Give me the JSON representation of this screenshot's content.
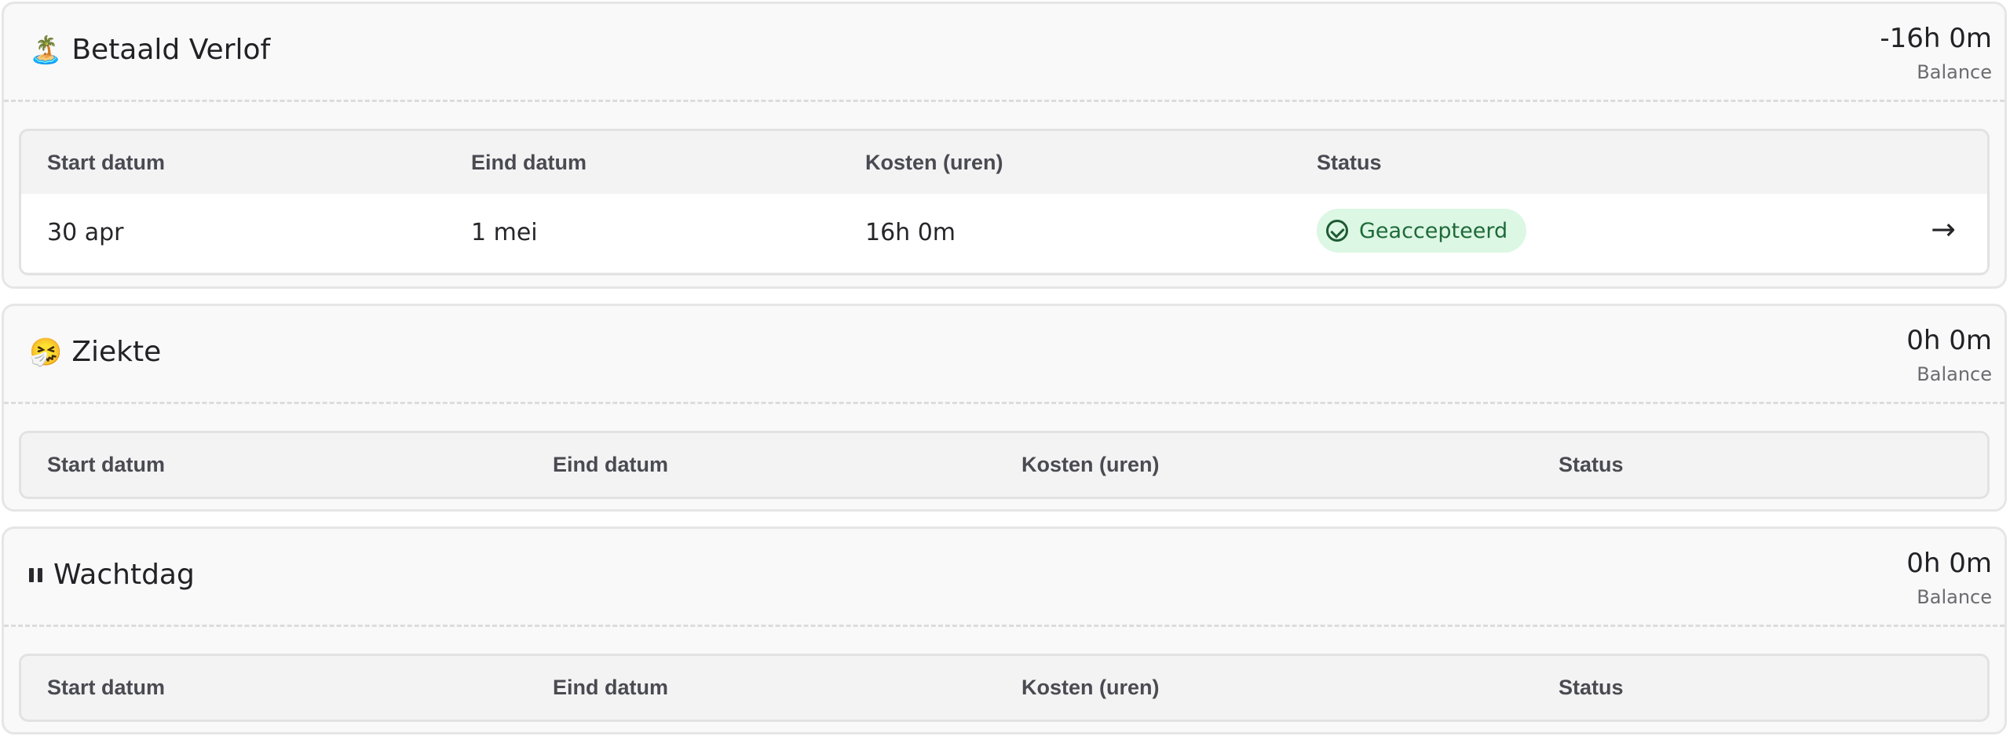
{
  "table_headers": {
    "start": "Start datum",
    "end": "Eind datum",
    "cost": "Kosten (uren)",
    "status": "Status"
  },
  "sections": [
    {
      "title": "Betaald Verlof",
      "emoji": "🏝️",
      "icon": "island-icon",
      "balance": "-16h 0m",
      "balance_label": "Balance",
      "rows": [
        {
          "start": "30 apr",
          "end": "1 mei",
          "cost": "16h 0m",
          "status": "Geaccepteerd"
        }
      ]
    },
    {
      "title": "Ziekte",
      "emoji": "🤧",
      "icon": "sneezing-face-icon",
      "balance": "0h 0m",
      "balance_label": "Balance",
      "rows": []
    },
    {
      "title": "Wachtdag",
      "emoji": "⏸",
      "icon": "pause-icon",
      "balance": "0h 0m",
      "balance_label": "Balance",
      "rows": []
    }
  ],
  "colors": {
    "status_accepted_bg": "#dcf7e3",
    "status_accepted_text": "#1e6a3a"
  }
}
